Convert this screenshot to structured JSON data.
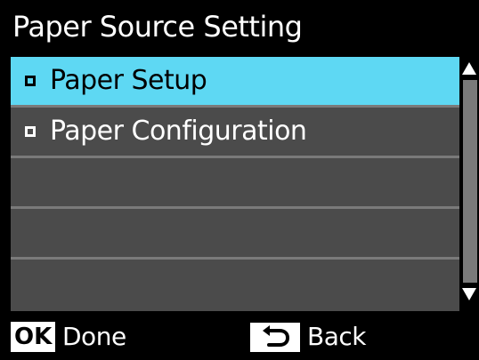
{
  "title": "Paper Source Setting",
  "menu": {
    "items": [
      {
        "label": "Paper Setup",
        "selected": true
      },
      {
        "label": "Paper Configuration",
        "selected": false
      },
      {
        "label": "",
        "selected": false
      },
      {
        "label": "",
        "selected": false
      },
      {
        "label": "",
        "selected": false
      }
    ]
  },
  "footer": {
    "ok_key": "OK",
    "ok_label": "Done",
    "back_label": "Back"
  },
  "icons": {
    "bullet": "square-bullet-icon",
    "scroll_up": "scroll-up-arrow-icon",
    "scroll_down": "scroll-down-arrow-icon",
    "back": "back-arrow-icon"
  },
  "colors": {
    "selection": "#5ed8f3",
    "menu_background": "#4b4b4b",
    "screen_background": "#000000"
  }
}
